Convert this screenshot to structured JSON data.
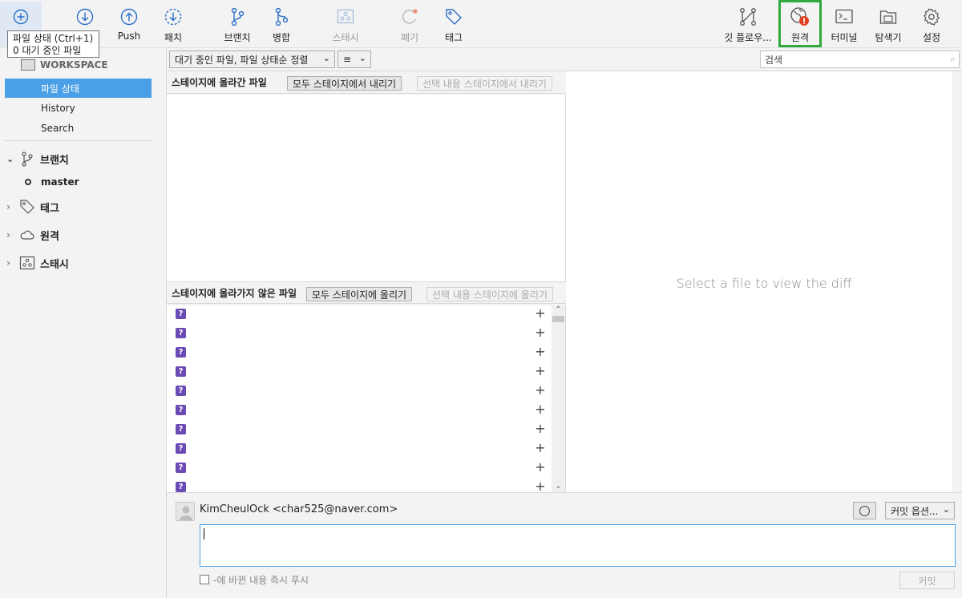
{
  "toolbar": {
    "items": [
      {
        "label": "",
        "icon": "plus-circle-icon"
      },
      {
        "label": "",
        "icon": "arrow-down-circle-icon"
      },
      {
        "label": "Push",
        "icon": "arrow-up-circle-icon"
      },
      {
        "label": "패치",
        "icon": "fetch-icon"
      },
      {
        "label": "브랜치",
        "icon": "branch-icon"
      },
      {
        "label": "병합",
        "icon": "merge-icon"
      },
      {
        "label": "스태시",
        "icon": "stash-icon"
      },
      {
        "label": "폐기",
        "icon": "discard-icon"
      },
      {
        "label": "태그",
        "icon": "tag-icon"
      },
      {
        "label": "깃 플로우...",
        "icon": "git-flow-icon"
      },
      {
        "label": "원격",
        "icon": "remote-globe-icon"
      },
      {
        "label": "터미널",
        "icon": "terminal-icon"
      },
      {
        "label": "탐색기",
        "icon": "explorer-icon"
      },
      {
        "label": "설정",
        "icon": "settings-gear-icon"
      }
    ],
    "highlight_color": "#2eaa3e",
    "alert_color": "#e0401f"
  },
  "tooltip": {
    "line1": "파일 상태 (Ctrl+1)",
    "line2": "0 대기 중인 파일"
  },
  "sidebar": {
    "workspace_label": "WORKSPACE",
    "workspace_items": [
      "파일 상태",
      "History",
      "Search"
    ],
    "selected_item": "파일 상태",
    "branches_label": "브랜치",
    "current_branch": "master",
    "tags_label": "태그",
    "remotes_label": "원격",
    "stashes_label": "스태시",
    "selection_color": "#4aa0e6"
  },
  "filter": {
    "sort_dropdown": "대기 중인 파일, 파일 상태순 정렬",
    "view_dropdown": "≡",
    "search_placeholder": "검색"
  },
  "staged": {
    "title": "스테이지에 올라간 파일",
    "unstage_all": "모두 스테이지에서 내리기",
    "unstage_selected": "선택 내용 스테이지에서 내리기"
  },
  "unstaged": {
    "title": "스테이지에 올라가지 않은 파일",
    "stage_all": "모두 스테이지에 올리기",
    "stage_selected": "선택 내용 스테이지에 올리기",
    "file_status_marker": "?",
    "file_count_visible": 10
  },
  "diff": {
    "placeholder": "Select a file to view the diff"
  },
  "commit": {
    "author": "KimCheulOck <char525@naver.com>",
    "options_label": "커밋 옵션...",
    "push_immediately_label": "-에 바뀐 내용 즉시 푸시",
    "commit_button": "커밋"
  }
}
